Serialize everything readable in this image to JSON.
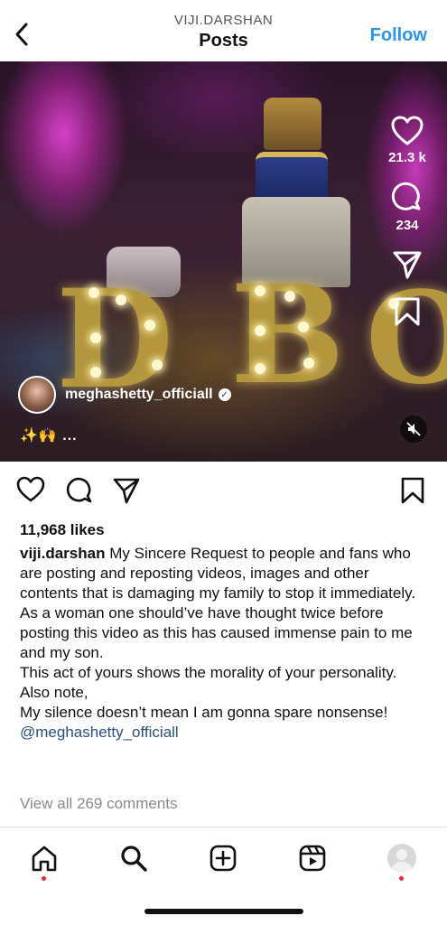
{
  "header": {
    "account": "VIJI.DARSHAN",
    "title": "Posts",
    "follow_label": "Follow"
  },
  "media": {
    "likes_count": "21.3 k",
    "comments_count": "234",
    "author_name": "meghashetty_officiall",
    "audio_line": "✨🙌 ...",
    "icons": [
      "heart-icon",
      "comment-icon",
      "share-icon",
      "bookmark-icon",
      "mute-icon"
    ]
  },
  "post": {
    "likes": "11,968 likes",
    "caption_user": "viji.darshan",
    "caption_lines": [
      "My Sincere Request to people and fans who are posting and reposting videos, images and other contents that is damaging my family to stop it immediately.",
      "As a woman one should’ve have thought twice before posting this video as this has caused immense pain to me and my son.",
      "This act of yours shows the morality of your personality.",
      "Also note,",
      "My silence doesn’t mean I am gonna spare nonsense!"
    ],
    "mention": "@meghashetty_officiall",
    "view_comments": "View all 269 comments"
  },
  "nav": {
    "items": [
      "home",
      "search",
      "create",
      "reels",
      "profile"
    ]
  },
  "colors": {
    "accent": "#2a95ea",
    "notification_dot": "#e8253f",
    "mention": "#29517d"
  }
}
